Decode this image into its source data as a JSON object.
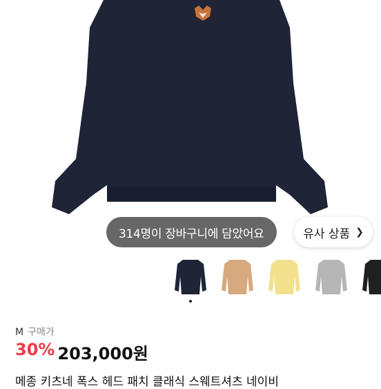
{
  "cart_banner": {
    "text": "314명이 장바구니에 담았어요"
  },
  "similar_button": {
    "label": "유사 상품",
    "icon": "chevron-right-icon"
  },
  "color_options": [
    {
      "name": "navy",
      "color": "#1f2436",
      "selected": true
    },
    {
      "name": "beige",
      "color": "#d7a97e",
      "selected": false
    },
    {
      "name": "yellow",
      "color": "#f2e08d",
      "selected": false
    },
    {
      "name": "gray",
      "color": "#b6b6b6",
      "selected": false
    },
    {
      "name": "black",
      "color": "#202020",
      "selected": false
    }
  ],
  "product": {
    "size": "M",
    "purchase_label": "구매가",
    "discount": "30%",
    "price": "203,000원",
    "title": "메종 키츠네 폭스 헤드 패치 클래식 스웨트셔츠 네이비"
  },
  "colors": {
    "discount": "#f03a4a",
    "sweatshirt": "#1f2436"
  }
}
